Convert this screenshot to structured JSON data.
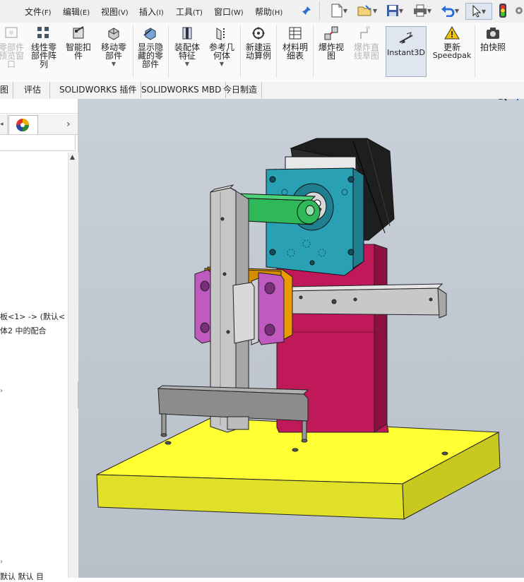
{
  "menubar": {
    "items": [
      {
        "label": "文件",
        "accel": "(F)"
      },
      {
        "label": "编辑",
        "accel": "(E)"
      },
      {
        "label": "视图",
        "accel": "(V)"
      },
      {
        "label": "插入",
        "accel": "(I)"
      },
      {
        "label": "工具",
        "accel": "(T)"
      },
      {
        "label": "窗口",
        "accel": "(W)"
      },
      {
        "label": "帮助",
        "accel": "(H)"
      }
    ]
  },
  "ribbon": {
    "buttons": [
      {
        "label": "零部件预览窗口",
        "lines": [
          "零部件",
          "预览窗",
          "口"
        ],
        "enabled": false
      },
      {
        "label": "线性零部件阵列",
        "lines": [
          "线性零",
          "部件阵",
          "列"
        ],
        "enabled": true
      },
      {
        "label": "智能扣件",
        "lines": [
          "智能扣",
          "件"
        ],
        "enabled": true
      },
      {
        "label": "移动零部件",
        "lines": [
          "移动零",
          "部件"
        ],
        "enabled": true
      },
      {
        "label": "显示隐藏的零部件",
        "lines": [
          "显示隐",
          "藏的零",
          "部件"
        ],
        "enabled": true
      },
      {
        "label": "装配体特征",
        "lines": [
          "装配体",
          "特征"
        ],
        "enabled": true
      },
      {
        "label": "参考几何体",
        "lines": [
          "参考几",
          "何体"
        ],
        "enabled": true
      },
      {
        "label": "新建运动算例",
        "lines": [
          "新建运",
          "动算例"
        ],
        "enabled": true
      },
      {
        "label": "材料明细表",
        "lines": [
          "材料明",
          "细表"
        ],
        "enabled": true
      },
      {
        "label": "爆炸视图",
        "lines": [
          "爆炸视",
          "图"
        ],
        "enabled": true
      },
      {
        "label": "爆炸直线草图",
        "lines": [
          "爆炸直",
          "线草图"
        ],
        "enabled": false
      },
      {
        "label": "Instant3D",
        "lines": [
          "Instant3D"
        ],
        "enabled": true
      },
      {
        "label": "更新Speedpak",
        "lines": [
          "更新",
          "Speedpak"
        ],
        "enabled": true
      },
      {
        "label": "拍快照",
        "lines": [
          "拍快照"
        ],
        "enabled": true
      }
    ]
  },
  "tabs": [
    {
      "label": "图"
    },
    {
      "label": "评估"
    },
    {
      "label": "SOLIDWORKS 插件"
    },
    {
      "label": "SOLIDWORKS MBD"
    },
    {
      "label": "今日制造"
    }
  ],
  "tree": {
    "line1": "板<1> -> (默认<",
    "line2": "体2 中的配合",
    "bottom1": "默认    默认    目"
  },
  "colors": {
    "base_plate": "#ffff33",
    "motor_mount": "#2aa0b4",
    "motor_body": "#1e1e1e",
    "arm_link": "#2fb85a",
    "column": "#c0195a",
    "slide_block": "#c05ac0",
    "orange_plate": "#e89a00",
    "rails": "#c8c8c8",
    "viewport_bg": "#c2c9d2"
  }
}
